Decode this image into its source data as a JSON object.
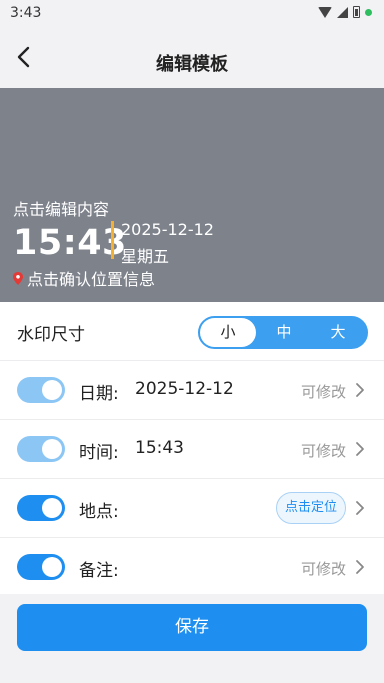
{
  "status_bar": {
    "time": "3:43"
  },
  "nav": {
    "title": "编辑模板"
  },
  "preview": {
    "edit_hint": "点击编辑内容",
    "time": "15:43",
    "date": "2025-12-12",
    "weekday": "星期五",
    "location": "点击确认位置信息"
  },
  "size_row": {
    "label": "水印尺寸",
    "options": [
      "小",
      "中",
      "大"
    ],
    "selected": "小"
  },
  "fields": [
    {
      "label": "日期:",
      "value": "2025-12-12",
      "hint": "可修改",
      "enabled": true
    },
    {
      "label": "时间:",
      "value": "15:43",
      "hint": "可修改",
      "enabled": true
    },
    {
      "label": "地点:",
      "value": "",
      "action": "点击定位",
      "enabled": true
    },
    {
      "label": "备注:",
      "value": "",
      "hint": "可修改",
      "enabled": true
    }
  ],
  "save_button": {
    "label": "保存"
  },
  "colors": {
    "accent": "#1e8ff0",
    "preview_bg": "#7d828b",
    "divider": "#f2b132"
  }
}
